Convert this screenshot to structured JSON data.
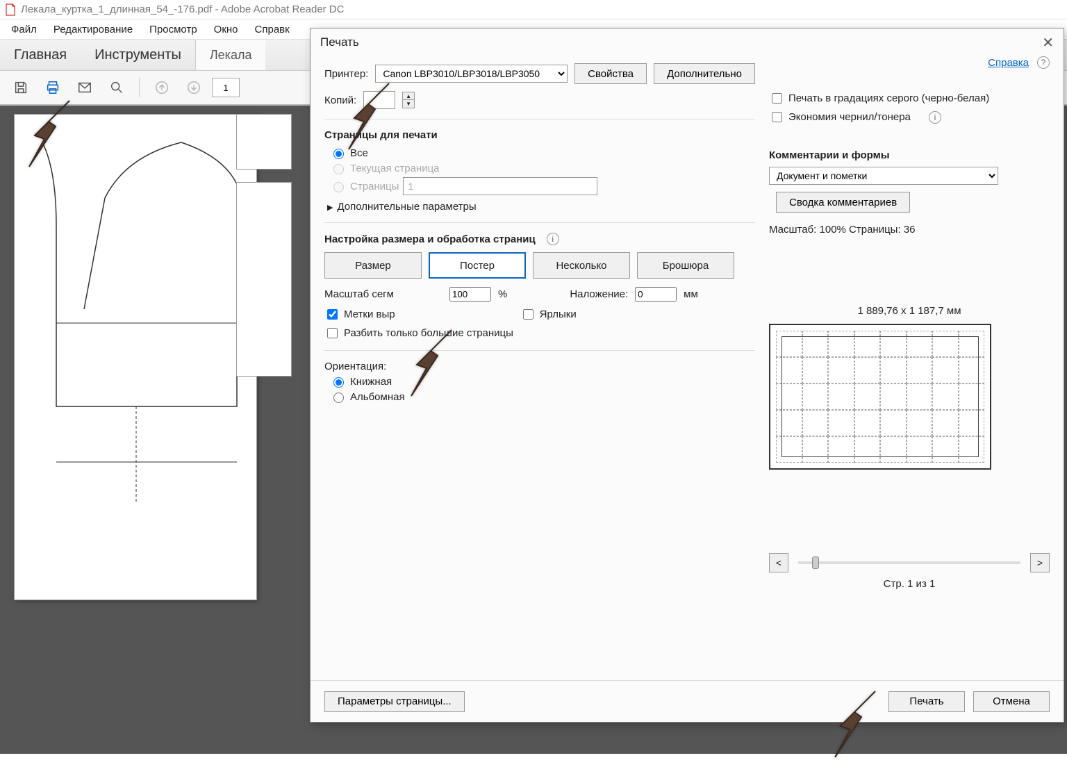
{
  "window": {
    "title": "Лекала_куртка_1_длинная_54_-176.pdf - Adobe Acrobat Reader DC"
  },
  "menu": {
    "file": "Файл",
    "edit": "Редактирование",
    "view": "Просмотр",
    "window": "Окно",
    "help": "Справк"
  },
  "tabs": {
    "home": "Главная",
    "tools": "Инструменты",
    "doc": "Лекала"
  },
  "toolbar": {
    "page": "1"
  },
  "dialog": {
    "title": "Печать",
    "printer_label": "Принтер:",
    "printer_value": "Canon LBP3010/LBP3018/LBP3050",
    "properties": "Свойства",
    "advanced": "Дополнительно",
    "help_link": "Справка",
    "copies_label": "Копий:",
    "copies_value": "",
    "grayscale": "Печать в градациях серого (черно-белая)",
    "economy": "Экономия чернил/тонера",
    "pages_section": "Страницы для печати",
    "radio_all": "Все",
    "radio_current": "Текущая страница",
    "radio_pages": "Страницы",
    "pages_value": "1",
    "more_params": "Дополнительные параметры",
    "size_section": "Настройка размера и обработка страниц",
    "seg_size": "Размер",
    "seg_poster": "Постер",
    "seg_multi": "Несколько",
    "seg_booklet": "Брошюра",
    "scale_label": "Масштаб сегм",
    "scale_value": "100",
    "scale_pct": "%",
    "overlap_label": "Наложение:",
    "overlap_value": "0",
    "overlap_unit": "мм",
    "chk_marks": "Метки выр",
    "chk_labels": "Ярлыки",
    "chk_split": "Разбить только большие страницы",
    "orient_section": "Ориентация:",
    "orient_portrait": "Книжная",
    "orient_landscape": "Альбомная",
    "comments_section": "Комментарии и формы",
    "comments_value": "Документ и пометки",
    "summary_btn": "Сводка комментариев",
    "scale_info": "Масштаб: 100% Страницы: 36",
    "preview_dims": "1 889,76 x 1 187,7 мм",
    "page_of": "Стр. 1 из 1",
    "page_setup": "Параметры страницы...",
    "print_btn": "Печать",
    "cancel_btn": "Отмена"
  }
}
